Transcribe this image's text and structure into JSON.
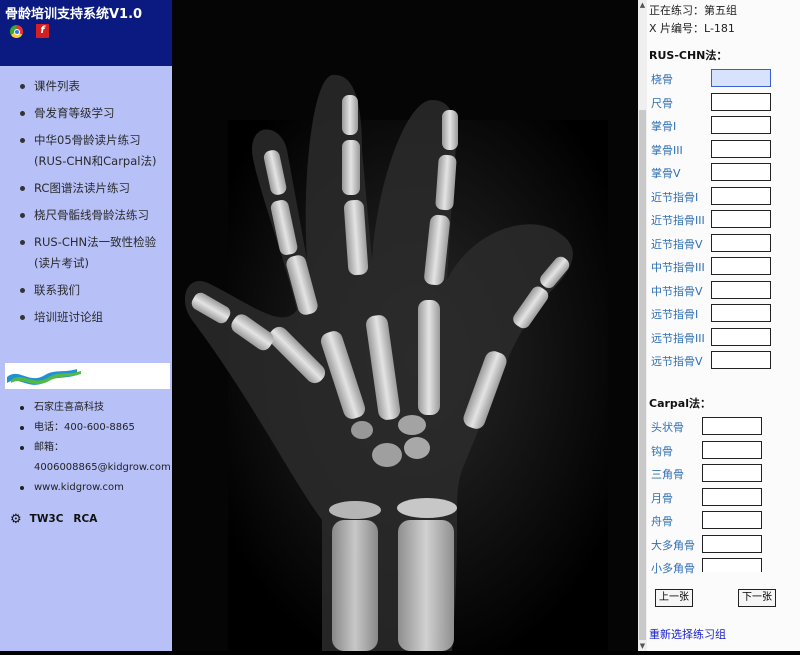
{
  "app": {
    "title": "骨龄培训支持系统V1.0"
  },
  "sidebar": {
    "nav": [
      {
        "label": "课件列表"
      },
      {
        "label": "骨发育等级学习"
      },
      {
        "label": "中华05骨龄读片练习(RUS-CHN和Carpal法)"
      },
      {
        "label": "RC图谱法读片练习"
      },
      {
        "label": "桡尺骨骺线骨龄法练习"
      },
      {
        "label": "RUS-CHN法一致性检验(读片考试)"
      },
      {
        "label": "联系我们"
      },
      {
        "label": "培训班讨论组"
      }
    ],
    "contact": [
      {
        "label": "石家庄喜高科技"
      },
      {
        "label": "电话：400-600-8865"
      },
      {
        "label": "邮箱："
      },
      {
        "label": "4006008865@kidgrow.com"
      },
      {
        "label": "www.kidgrow.com"
      }
    ],
    "tools": [
      "TW3C",
      "RCA"
    ]
  },
  "practice": {
    "current_line": "正在练习：第五组",
    "xray_id_line": "X 片编号：L-181"
  },
  "rus_chn": {
    "title": "RUS-CHN法：",
    "bones": [
      {
        "label": "桡骨",
        "value": ""
      },
      {
        "label": "尺骨",
        "value": ""
      },
      {
        "label": "掌骨I",
        "value": ""
      },
      {
        "label": "掌骨III",
        "value": ""
      },
      {
        "label": "掌骨V",
        "value": ""
      },
      {
        "label": "近节指骨I",
        "value": ""
      },
      {
        "label": "近节指骨III",
        "value": ""
      },
      {
        "label": "近节指骨V",
        "value": ""
      },
      {
        "label": "中节指骨III",
        "value": ""
      },
      {
        "label": "中节指骨V",
        "value": ""
      },
      {
        "label": "远节指骨I",
        "value": ""
      },
      {
        "label": "远节指骨III",
        "value": ""
      },
      {
        "label": "远节指骨V",
        "value": ""
      }
    ]
  },
  "carpal": {
    "title": "Carpal法：",
    "bones": [
      {
        "label": "头状骨",
        "value": ""
      },
      {
        "label": "钩骨",
        "value": ""
      },
      {
        "label": "三角骨",
        "value": ""
      },
      {
        "label": "月骨",
        "value": ""
      },
      {
        "label": "舟骨",
        "value": ""
      },
      {
        "label": "大多角骨",
        "value": ""
      },
      {
        "label": "小多角骨",
        "value": ""
      }
    ]
  },
  "buttons": {
    "prev": "上一张",
    "next": "下一张",
    "reselect": "重新选择练习组"
  },
  "icons": {
    "browser": "chrome-icon",
    "plugin": "flash-icon",
    "settings": "gear-icon"
  }
}
